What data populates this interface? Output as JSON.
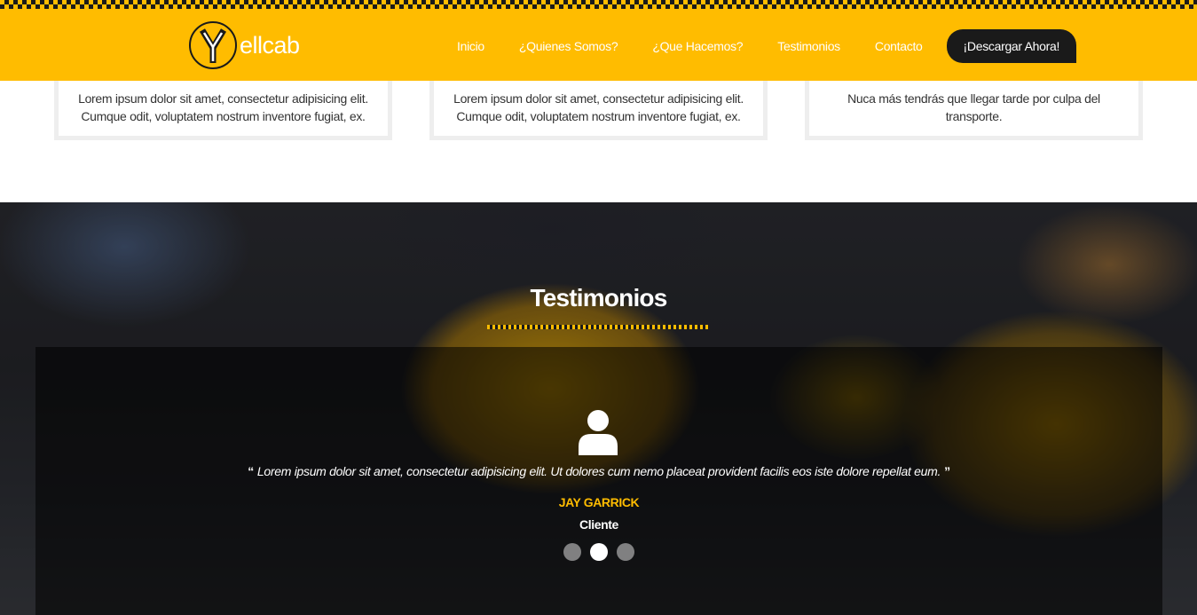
{
  "header": {
    "logo_text": "ellcab",
    "logo_letter": "Y",
    "nav": [
      "Inicio",
      "¿Quienes Somos?",
      "¿Que Hacemos?",
      "Testimonios",
      "Contacto"
    ],
    "cta": "¡Descargar Ahora!",
    "colors": {
      "brand": "#ffbc00",
      "dark": "#1a1a1a"
    }
  },
  "features": [
    {
      "text": "Lorem ipsum dolor sit amet, consectetur adipisicing elit. Cumque odit, voluptatem nostrum inventore fugiat, ex."
    },
    {
      "text": "Lorem ipsum dolor sit amet, consectetur adipisicing elit. Cumque odit, voluptatem nostrum inventore fugiat, ex."
    },
    {
      "text": "Nuca más tendrás que llegar tarde por culpa del transporte."
    }
  ],
  "testimonials": {
    "title": "Testimonios",
    "icon": "user-icon",
    "quote_open": "“",
    "quote": "Lorem ipsum dolor sit amet, consectetur adipisicing elit. Ut dolores cum nemo placeat provident facilis eos iste dolore repellat eum.",
    "quote_close": "”",
    "author": "JAY GARRICK",
    "role": "Cliente",
    "slides": 3,
    "active_slide": 2
  }
}
